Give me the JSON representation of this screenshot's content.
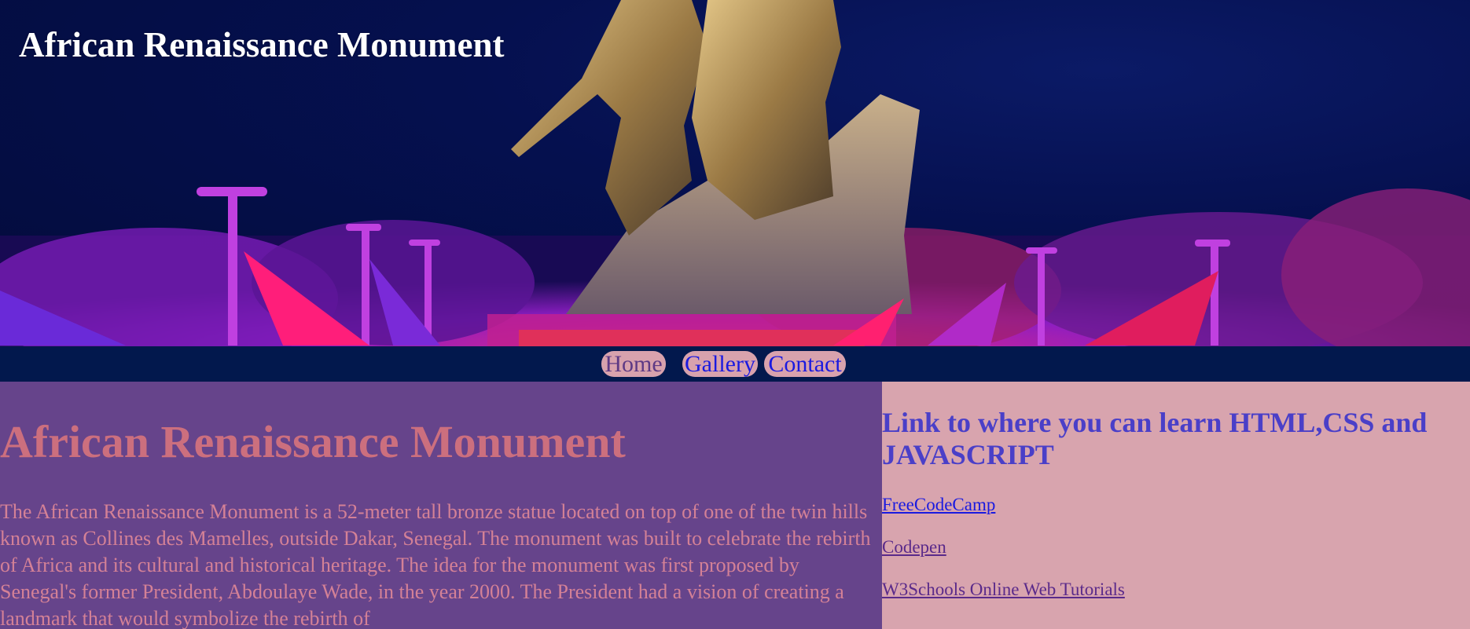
{
  "header": {
    "site_title": "African Renaissance Monument",
    "hero_image_icon": "monument-photo"
  },
  "nav": {
    "items": [
      {
        "label": "Home"
      },
      {
        "label": "Gallery"
      },
      {
        "label": "Contact"
      }
    ]
  },
  "main": {
    "title": "African Renaissance Monument",
    "paragraph": "The African Renaissance Monument is a 52-meter tall bronze statue located on top of one of the twin hills known as Collines des Mamelles, outside Dakar, Senegal. The monument was built to celebrate the rebirth of Africa and its cultural and historical heritage. The idea for the monument was first proposed by Senegal's former President, Abdoulaye Wade, in the year 2000. The President had a vision of creating a landmark that would symbolize the rebirth of"
  },
  "aside": {
    "title": "Link to where you can learn HTML,CSS and JAVASCRIPT",
    "links": [
      {
        "label": "FreeCodeCamp"
      },
      {
        "label": "Codepen"
      },
      {
        "label": "W3Schools Online Web Tutorials"
      }
    ]
  },
  "colors": {
    "nav_bar": "#02184d",
    "nav_pill": "#d8a2ad",
    "main_bg": "#66448b",
    "main_title": "#cc6f7e",
    "main_text": "#d48196",
    "aside_bg": "#d8a4ae",
    "aside_title": "#4a3fc8",
    "link_unvisited": "#1a1ae0",
    "link_visited": "#5a2a8a"
  }
}
